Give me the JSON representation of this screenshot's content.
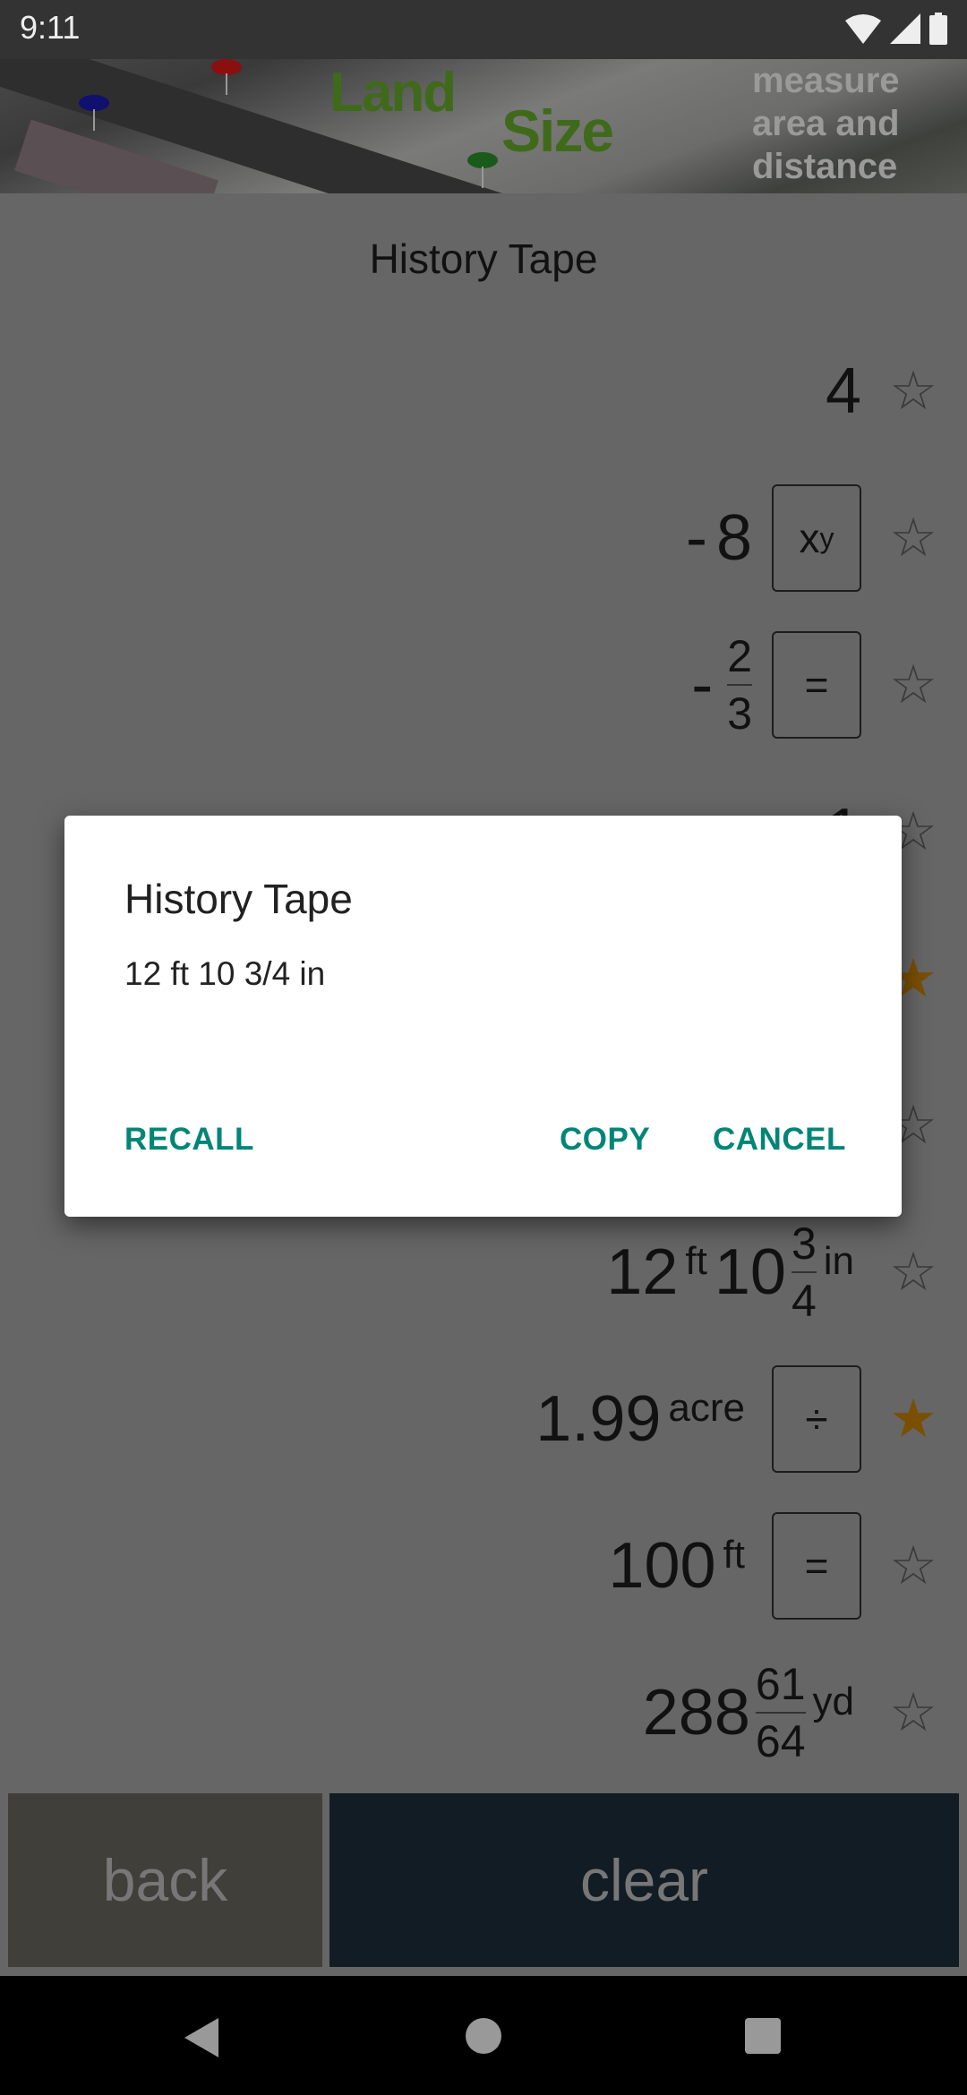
{
  "status_bar": {
    "time": "9:11",
    "icons": [
      "wifi-icon",
      "cell-signal-icon",
      "battery-icon"
    ]
  },
  "banner": {
    "logo_line1": "Land",
    "logo_line2": "Size",
    "tagline": [
      "measure",
      "area and",
      "distance"
    ]
  },
  "header": {
    "title": "History Tape"
  },
  "history": [
    {
      "parts": [
        {
          "t": "num",
          "v": "4"
        }
      ],
      "op": null,
      "starred": false
    },
    {
      "parts": [
        {
          "t": "sign",
          "v": "-"
        },
        {
          "t": "num",
          "v": "8"
        }
      ],
      "op": {
        "base": "x",
        "sup": "y"
      },
      "starred": false
    },
    {
      "parts": [
        {
          "t": "sign",
          "v": "-"
        },
        {
          "t": "frac",
          "n": "2",
          "d": "3"
        }
      ],
      "op": {
        "base": "="
      },
      "starred": false
    },
    {
      "parts": [
        {
          "t": "num",
          "v": "1"
        }
      ],
      "op": null,
      "starred": false
    },
    {
      "parts": [],
      "op": null,
      "starred": true
    },
    {
      "parts": [],
      "op": null,
      "starred": false
    },
    {
      "parts": [
        {
          "t": "num",
          "v": "12"
        },
        {
          "t": "unit",
          "v": "ft"
        },
        {
          "t": "num",
          "v": "10"
        },
        {
          "t": "frac",
          "n": "3",
          "d": "4"
        },
        {
          "t": "unit",
          "v": "in"
        }
      ],
      "op": null,
      "starred": false
    },
    {
      "parts": [
        {
          "t": "num",
          "v": "1.99"
        },
        {
          "t": "unit",
          "v": "acre"
        }
      ],
      "op": {
        "base": "÷"
      },
      "starred": true
    },
    {
      "parts": [
        {
          "t": "num",
          "v": "100"
        },
        {
          "t": "unit",
          "v": "ft"
        }
      ],
      "op": {
        "base": "="
      },
      "starred": false
    },
    {
      "parts": [
        {
          "t": "num",
          "v": "288"
        },
        {
          "t": "frac",
          "n": "61",
          "d": "64"
        },
        {
          "t": "unit",
          "v": "yd"
        }
      ],
      "op": null,
      "starred": false
    }
  ],
  "buttons": {
    "back": "back",
    "clear": "clear"
  },
  "dialog": {
    "title": "History Tape",
    "message": "12 ft 10 3/4 in",
    "recall": "RECALL",
    "copy": "COPY",
    "cancel": "CANCEL"
  },
  "colors": {
    "accent": "#008577",
    "star_filled": "#7a4f00",
    "back_button": "#413f3a",
    "clear_button": "#121c24"
  },
  "nav_bar": {
    "icons": [
      "back-triangle-icon",
      "home-circle-icon",
      "recents-square-icon"
    ]
  }
}
